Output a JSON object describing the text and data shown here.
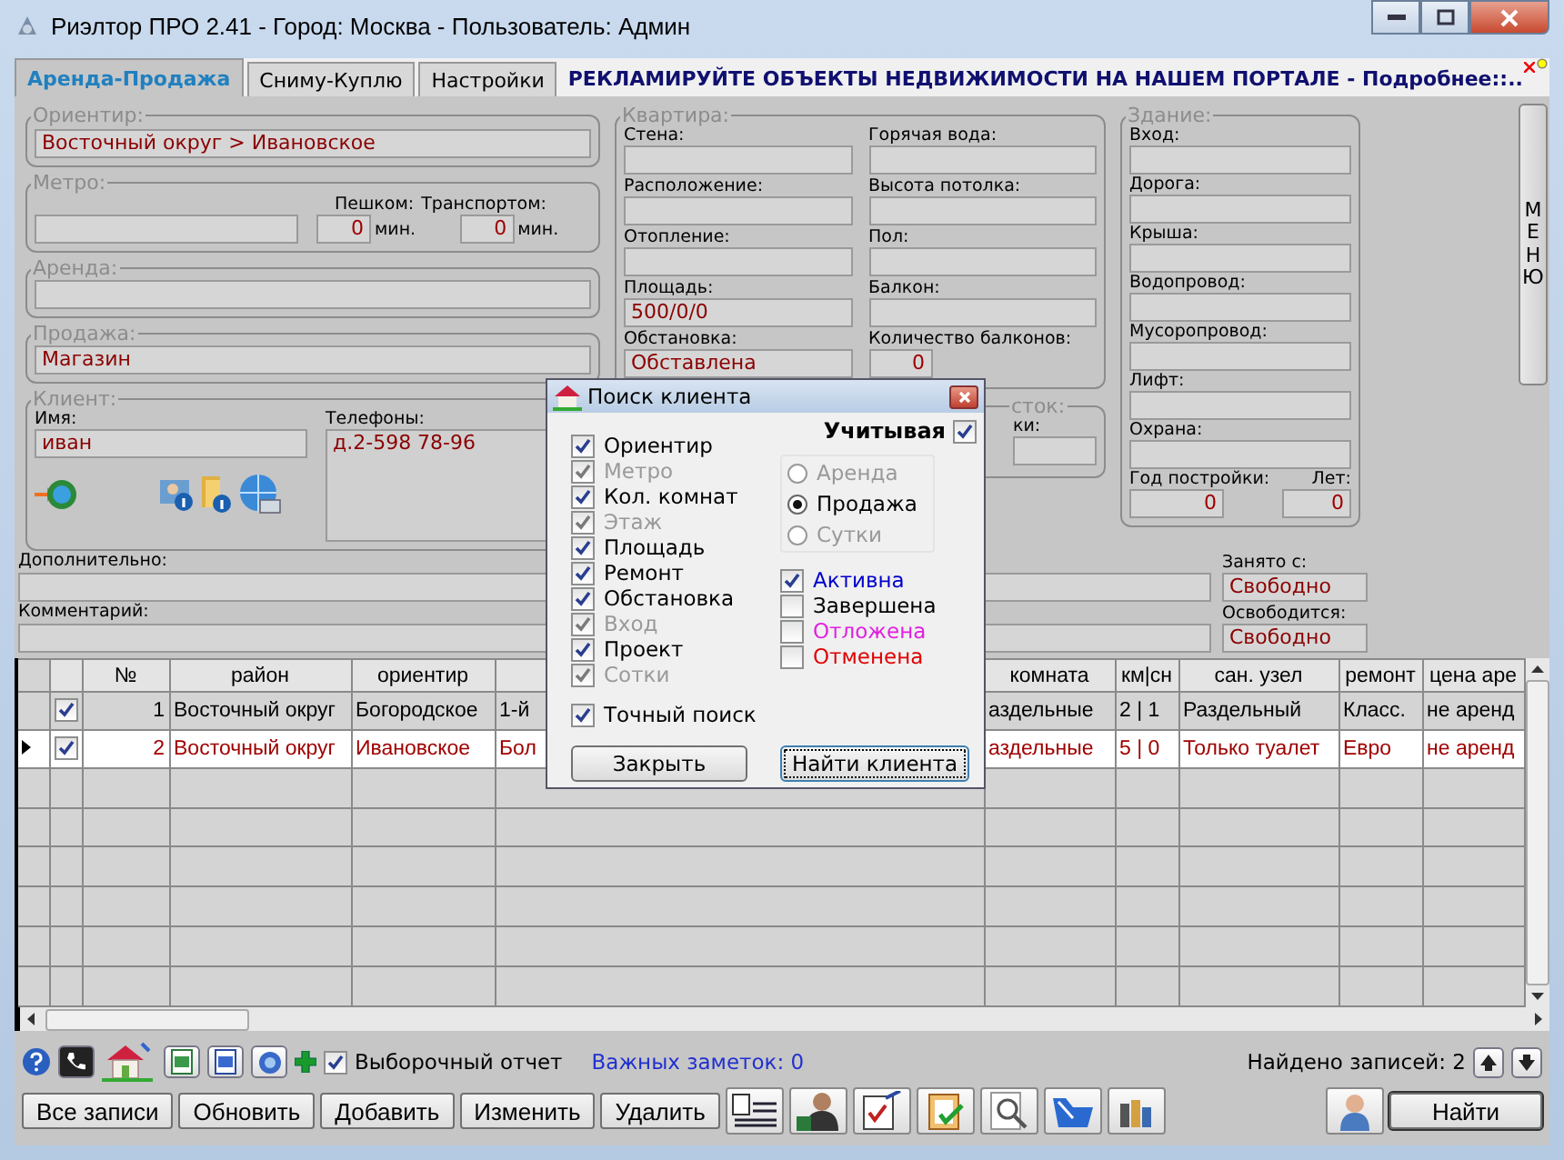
{
  "window": {
    "title": "Риэлтор ПРО 2.41 - Город: Москва - Пользователь: Админ"
  },
  "tabs": [
    {
      "label": "Аренда-Продажа",
      "selected": true
    },
    {
      "label": "Сниму-Куплю",
      "selected": false
    },
    {
      "label": "Настройки",
      "selected": false
    }
  ],
  "banner": "РЕКЛАМИРУЙТЕ ОБЪЕКТЫ НЕДВИЖИМОСТИ НА НАШЕМ ПОРТАЛЕ - Подробнее::..",
  "menu_button": "МЕНЮ",
  "landmark": {
    "title": "Ориентир:",
    "value": "Восточный округ > Ивановское"
  },
  "metro": {
    "title": "Метро:",
    "walk_label": "Пешком:",
    "transport_label": "Транспортом:",
    "walk": "0",
    "transport": "0",
    "unit_walk": "мин.",
    "unit_transport": "мин."
  },
  "rent": {
    "title": "Аренда:"
  },
  "sale": {
    "title": "Продажа:",
    "value": "Магазин"
  },
  "client": {
    "title": "Клиент:",
    "name_label": "Имя:",
    "name": "иван",
    "phones_label": "Телефоны:",
    "phones": "д.2-598 78-96"
  },
  "apartment": {
    "title": "Квартира:",
    "left": [
      {
        "label": "Стена:"
      },
      {
        "label": "Расположение:"
      },
      {
        "label": "Отопление:"
      },
      {
        "label": "Площадь:",
        "value": "500/0/0"
      },
      {
        "label": "Обстановка:",
        "value": "Обставлена"
      }
    ],
    "right": [
      {
        "label": "Горячая вода:",
        "kind": "text"
      },
      {
        "label": "Высота потолка:",
        "kind": "text"
      },
      {
        "label": "Пол:",
        "kind": "text"
      },
      {
        "label": "Балкон:",
        "kind": "text"
      },
      {
        "label": "Количество балконов:",
        "value": "0",
        "kind": "number"
      }
    ]
  },
  "plot": {
    "title": "сток:",
    "label": "ки:"
  },
  "building": {
    "title": "Здание:",
    "fields": [
      {
        "label": "Вход:"
      },
      {
        "label": "Дорога:"
      },
      {
        "label": "Крыша:"
      },
      {
        "label": "Водопровод:"
      },
      {
        "label": "Мусоропровод:"
      },
      {
        "label": "Лифт:"
      },
      {
        "label": "Охрана:"
      }
    ],
    "year_label": "Год постройки:",
    "year": "0",
    "age_label": "Лет:",
    "age": "0"
  },
  "extra": {
    "label": "Дополнительно:",
    "side_label": "Занято с:",
    "side_value": "Свободно"
  },
  "comment": {
    "label": "Комментарий:",
    "side_label": "Освободится:",
    "side_value": "Свободно"
  },
  "table": {
    "columns": [
      {
        "label": "№"
      },
      {
        "label": "район"
      },
      {
        "label": "ориентир"
      },
      {},
      {
        "label": "комната"
      },
      {
        "label": "км|сн"
      },
      {
        "label": "сан. узел"
      },
      {
        "label": "ремонт"
      },
      {
        "label": "цена аре"
      }
    ],
    "rows": [
      {
        "checked": true,
        "selected": false,
        "cells": [
          "1",
          "Восточный округ",
          "Богородское",
          "1-й",
          "аздельные",
          "2 | 1",
          "Раздельный",
          "Класс.",
          "не аренд"
        ]
      },
      {
        "checked": true,
        "selected": true,
        "cells": [
          "2",
          "Восточный округ",
          "Ивановское",
          "Бол",
          "аздельные",
          "5 | 0",
          "Только туалет",
          "Евро",
          "не аренд"
        ]
      }
    ]
  },
  "toolbar": {
    "report_label": "Выборочный отчет",
    "report_checked": true,
    "notes": "Важных заметок: 0",
    "found": "Найдено записей: 2"
  },
  "buttons": [
    "Все записи",
    "Обновить",
    "Добавить",
    "Изменить",
    "Удалить"
  ],
  "find_button": "Найти",
  "dialog": {
    "title": "Поиск клиента",
    "consider_label": "Учитывая",
    "consider_checked": true,
    "criteria": [
      {
        "label": "Ориентир",
        "checked": true,
        "disabled": false
      },
      {
        "label": "Метро",
        "checked": true,
        "disabled": true
      },
      {
        "label": "Кол. комнат",
        "checked": true,
        "disabled": false
      },
      {
        "label": "Этаж",
        "checked": true,
        "disabled": true
      },
      {
        "label": "Площадь",
        "checked": true,
        "disabled": false
      },
      {
        "label": "Ремонт",
        "checked": true,
        "disabled": false
      },
      {
        "label": "Обстановка",
        "checked": true,
        "disabled": false
      },
      {
        "label": "Вход",
        "checked": true,
        "disabled": true
      },
      {
        "label": "Проект",
        "checked": true,
        "disabled": false
      },
      {
        "label": "Сотки",
        "checked": true,
        "disabled": true
      }
    ],
    "deal_types": [
      {
        "label": "Аренда",
        "selected": false,
        "disabled": true
      },
      {
        "label": "Продажа",
        "selected": true,
        "disabled": false
      },
      {
        "label": "Сутки",
        "selected": false,
        "disabled": true
      }
    ],
    "statuses": [
      {
        "label": "Активна",
        "checked": true,
        "color": "#0000cc"
      },
      {
        "label": "Завершена",
        "checked": false,
        "color": "#000000"
      },
      {
        "label": "Отложена",
        "checked": false,
        "color": "#e020e0"
      },
      {
        "label": "Отменена",
        "checked": false,
        "color": "#e00000"
      }
    ],
    "exact_label": "Точный поиск",
    "exact_checked": true,
    "close_button": "Закрыть",
    "find_button": "Найти клиента"
  }
}
